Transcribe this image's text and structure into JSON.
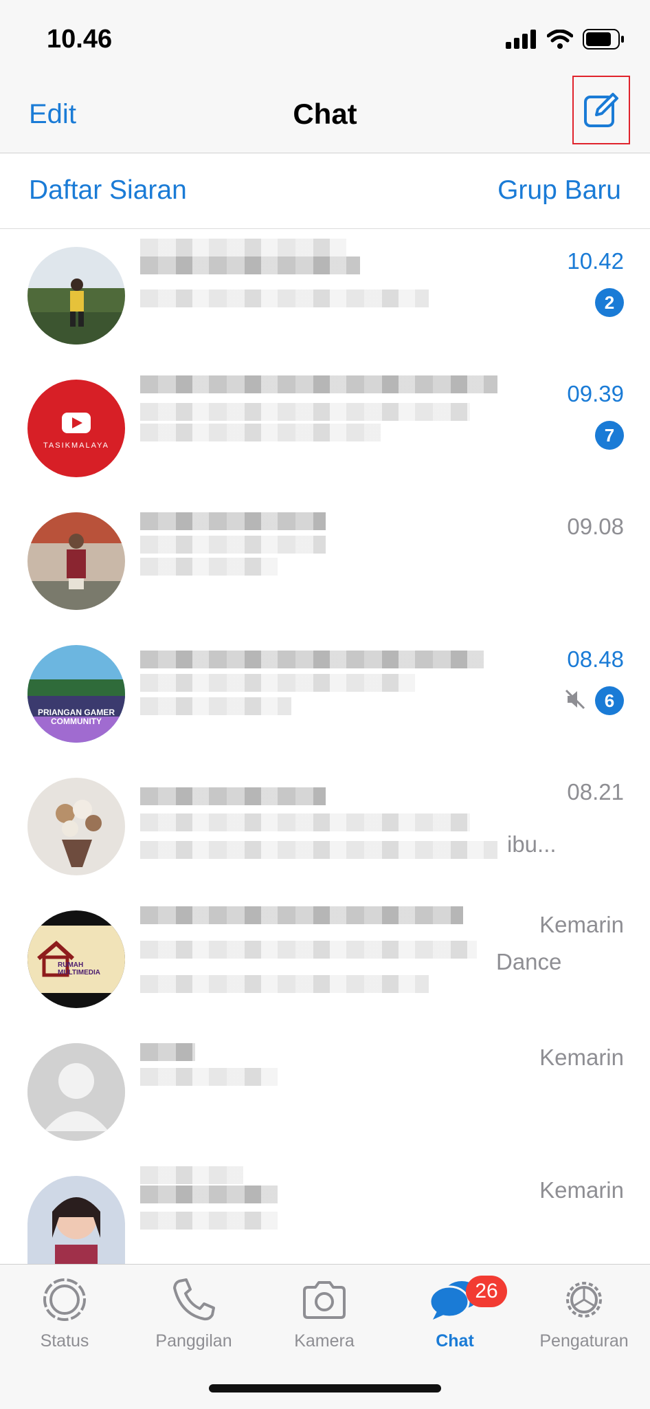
{
  "status_bar": {
    "time": "10.46",
    "icons": [
      "signal-icon",
      "wifi-icon",
      "battery-icon"
    ]
  },
  "nav": {
    "edit_label": "Edit",
    "title": "Chat",
    "compose_icon": "compose-icon"
  },
  "actions": {
    "broadcast_label": "Daftar Siaran",
    "new_group_label": "Grup Baru"
  },
  "chats": [
    {
      "time": "10.42",
      "unread": 2,
      "unread_style": true
    },
    {
      "time": "09.39",
      "unread": 7,
      "unread_style": true
    },
    {
      "time": "09.08",
      "unread": null,
      "unread_style": false
    },
    {
      "time": "08.48",
      "unread": 6,
      "unread_style": true,
      "muted": true
    },
    {
      "time": "08.21",
      "unread": null,
      "unread_style": false,
      "preview_tail": "ibu..."
    },
    {
      "time": "Kemarin",
      "unread": null,
      "unread_style": false,
      "preview_tail": "Dance"
    },
    {
      "time": "Kemarin",
      "unread": null,
      "unread_style": false
    },
    {
      "time": "Kemarin",
      "unread": null,
      "unread_style": false
    }
  ],
  "avatars": {
    "row2_text": "TASIKMALAYA",
    "row4_text": "PRIANGAN GAMER COMMUNITY",
    "row6_text": "RUMAH MULTIMEDIA"
  },
  "tabbar": {
    "tabs": [
      {
        "label": "Status",
        "icon": "status-icon"
      },
      {
        "label": "Panggilan",
        "icon": "phone-icon"
      },
      {
        "label": "Kamera",
        "icon": "camera-icon"
      },
      {
        "label": "Chat",
        "icon": "chat-bubbles-icon",
        "badge": "26",
        "active": true
      },
      {
        "label": "Pengaturan",
        "icon": "gear-icon"
      }
    ]
  },
  "colors": {
    "accent": "#1a7bd6",
    "badge_red": "#f23b32",
    "secondary_text": "#8e8e93",
    "highlight_box": "#e0232c"
  }
}
